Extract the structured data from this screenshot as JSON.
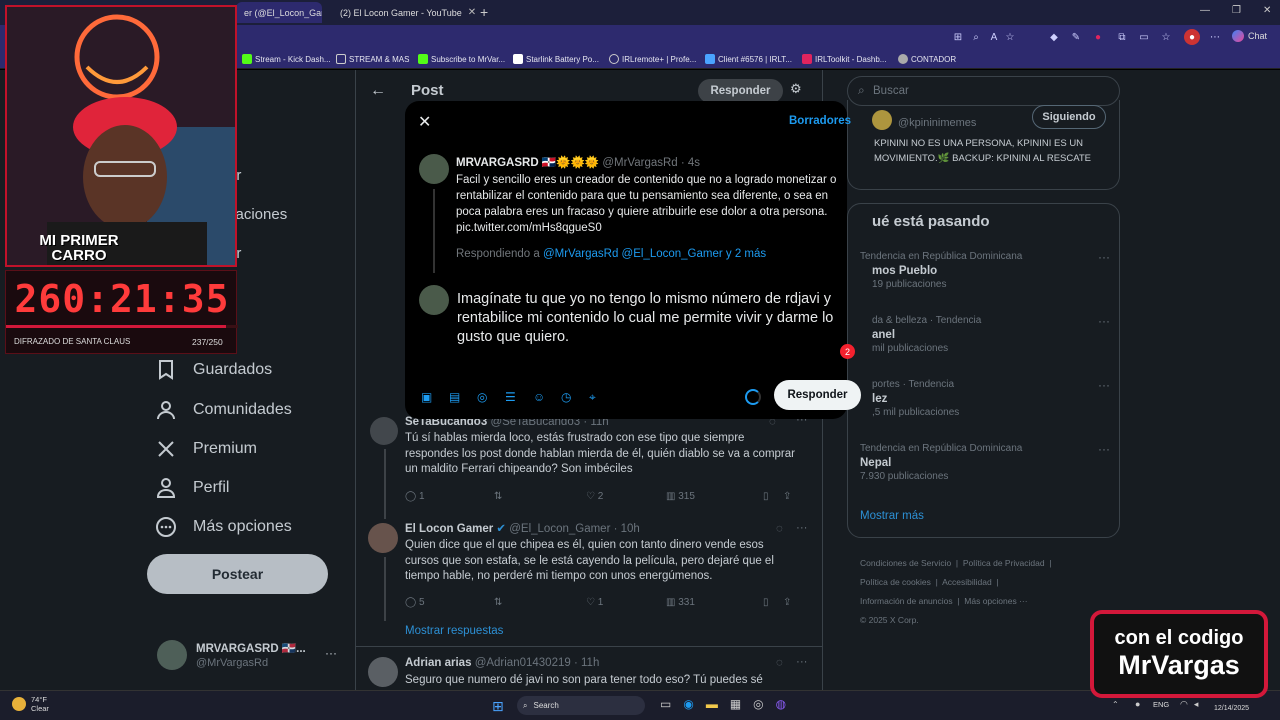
{
  "browser": {
    "tabs": [
      {
        "label": "er (@El_Locon_Gam..."
      },
      {
        "label": "(2) El Locon Gamer - YouTube"
      }
    ],
    "bookmarks": [
      {
        "label": "Stream - Kick Dash...",
        "color": "#53fc18"
      },
      {
        "label": "STREAM & MAS",
        "color": "#cccccc"
      },
      {
        "label": "Subscribe to MrVar...",
        "color": "#53fc18"
      },
      {
        "label": "Starlink Battery Po...",
        "color": "#ffffff"
      },
      {
        "label": "IRLremote+ | Profe...",
        "color": "#cccccc"
      },
      {
        "label": "Client #6576 | IRLT...",
        "color": "#4aa3ff"
      },
      {
        "label": "IRLToolkit - Dashb...",
        "color": "#e0245e"
      },
      {
        "label": "CONTADOR",
        "color": "#aaaaaa"
      }
    ],
    "copilot_label": "Chat"
  },
  "header": {
    "title": "Post",
    "reply_button": "Responder",
    "search_placeholder": "Buscar"
  },
  "nav": {
    "partial_items": [
      "ar",
      "caciones",
      "ar"
    ],
    "items": [
      {
        "label": "Guardados",
        "icon": "bookmark-icon"
      },
      {
        "label": "Comunidades",
        "icon": "communities-icon"
      },
      {
        "label": "Premium",
        "icon": "x-logo-icon"
      },
      {
        "label": "Perfil",
        "icon": "person-icon"
      },
      {
        "label": "Más opciones",
        "icon": "more-circle-icon"
      }
    ],
    "post_button": "Postear",
    "account": {
      "name": "MRVARGASRD 🇩🇴...",
      "handle": "@MrVargasRd"
    }
  },
  "modal": {
    "drafts": "Borradores",
    "original": {
      "name": "MRVARGASRD 🇩🇴🌞🌞🌞",
      "handle": "@MrVargasRd",
      "time": "· 4s",
      "text": "Facil y sencillo eres un creador de contenido que no a logrado monetizar o rentabilizar el contenido para que tu pensamiento sea diferente, o sea en poca palabra eres un fracaso y quiere atribuirle ese dolor a otra persona. pic.twitter.com/mHs8qgueS0"
    },
    "replying_prefix": "Respondiendo a",
    "replying_to": "@MrVargasRd @El_Locon_Gamer y 2 más",
    "draft_text": "Imagínate tu que yo no tengo lo mismo número de rdjavi y rentabilice mi contenido lo cual me permite vivir y darme lo gusto que quiero.",
    "char_badge": "2",
    "submit": "Responder"
  },
  "replies": [
    {
      "name": "SeTaBucando3",
      "handle": "@SeTaBucando3",
      "time": "· 11h",
      "text": "Tú sí hablas mierda loco, estás frustrado con ese tipo que siempre respondes los post donde hablan mierda de él, quién diablo se va a comprar un maldito Ferrari chipeando? Son imbéciles",
      "replies": "1",
      "retweets": "",
      "likes": "2",
      "views": "315"
    },
    {
      "name": "El Locon Gamer",
      "handle": "@El_Locon_Gamer",
      "time": "· 10h",
      "text": "Quien dice que el que chipea es él, quien con tanto dinero vende esos cursos que son estafa, se le está cayendo la película, pero dejaré que el tiempo hable, no perderé mi tiempo con unos energúmenos.",
      "replies": "5",
      "retweets": "",
      "likes": "1",
      "views": "331"
    },
    {
      "name": "Adrian arias",
      "handle": "@Adrian01430219",
      "time": "· 11h",
      "text": "Seguro que numero dé javi no son para tener todo eso? Tú puedes sé"
    }
  ],
  "show_replies": "Mostrar respuestas",
  "sidebar": {
    "follow_card": {
      "handle": "@kpininimemes",
      "button": "Siguiendo",
      "bio": "KPININI NO ES UNA PERSONA, KPININI ES UN MOVIMIENTO.🌿 BACKUP: KPININI AL RESCATE"
    },
    "trends_title": "ué está pasando",
    "trends": [
      {
        "context": "Tendencia en República Dominicana",
        "name": "mos Pueblo",
        "count": "19 publicaciones"
      },
      {
        "context": "da & belleza · Tendencia",
        "name": "anel",
        "count": "mil publicaciones"
      },
      {
        "context": "portes · Tendencia",
        "name": "lez",
        "count": ",5 mil publicaciones"
      },
      {
        "context": "Tendencia en República Dominicana",
        "name": "Nepal",
        "count": "7.930 publicaciones"
      }
    ],
    "show_more": "Mostrar más",
    "footer": [
      "Condiciones de Servicio",
      "Política de Privacidad",
      "Política de cookies",
      "Accesibilidad",
      "Información de anuncios",
      "Más opciones ···",
      "© 2025 X Corp."
    ]
  },
  "overlay": {
    "banner": "MI PRIMER CARRO",
    "timer": "260:21:35",
    "goal_label": "DIFRAZADO DE SANTA CLAUS",
    "goal_count": "237/250",
    "goal_fraction": 0.948,
    "promo_line1": "con el codigo",
    "promo_line2": "MrVargas"
  },
  "taskbar": {
    "weather_temp": "74°F",
    "weather_desc": "Clear",
    "search": "Search",
    "lang": "ENG",
    "date": "12/14/2025"
  },
  "colors": {
    "accent": "#1d9bf0",
    "promo_border": "#d3183a",
    "timer_red": "#ff3b3b"
  }
}
